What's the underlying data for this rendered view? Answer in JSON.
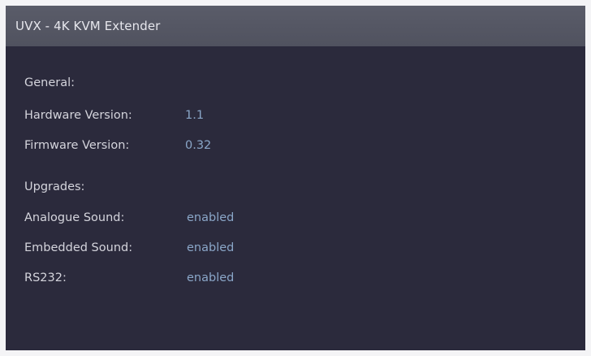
{
  "window": {
    "title": "UVX - 4K KVM Extender"
  },
  "general": {
    "heading": "General:",
    "hardware_label": "Hardware Version:",
    "hardware_value": "1.1",
    "firmware_label": "Firmware Version:",
    "firmware_value": "0.32"
  },
  "upgrades": {
    "heading": "Upgrades:",
    "items": [
      {
        "label": "Analogue Sound:",
        "value": "enabled"
      },
      {
        "label": "Embedded Sound:",
        "value": "enabled"
      },
      {
        "label": "RS232:",
        "value": "enabled"
      }
    ]
  },
  "colors": {
    "background": "#2b2a3c",
    "titlebar": "#55575f",
    "label_text": "#d4d4dc",
    "value_text": "#8aa6c8"
  }
}
